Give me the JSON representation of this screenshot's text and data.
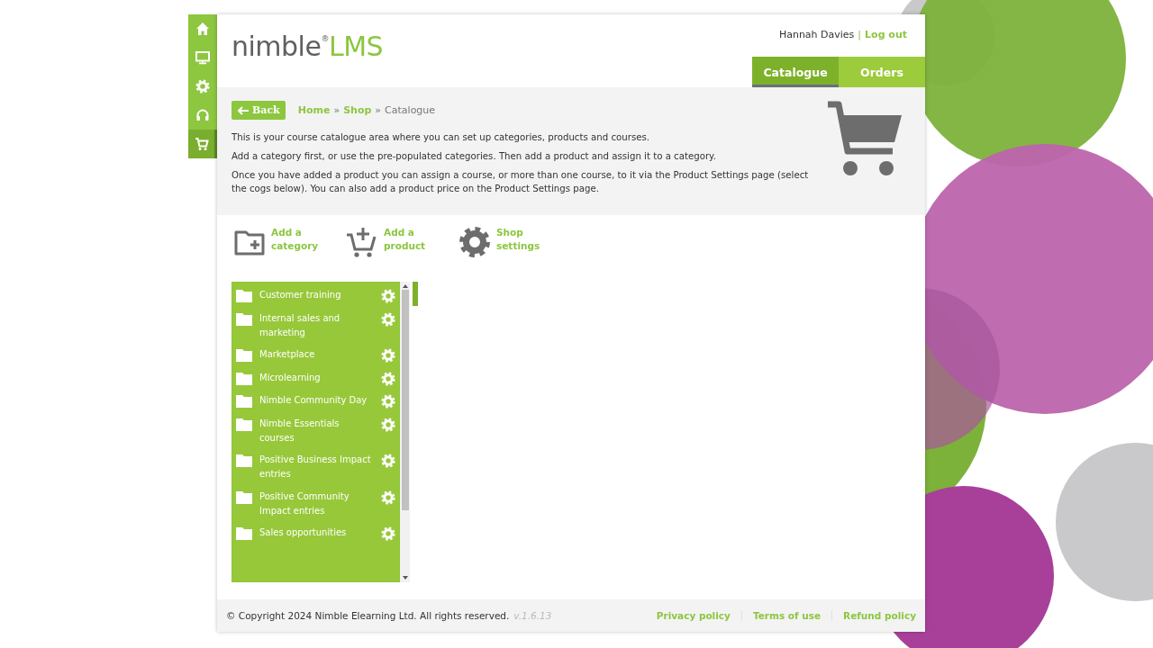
{
  "sidebar": {
    "items": [
      {
        "kind": "home",
        "selected": false
      },
      {
        "kind": "monitor",
        "selected": false
      },
      {
        "kind": "settings",
        "selected": false
      },
      {
        "kind": "headset",
        "selected": false
      },
      {
        "kind": "cart",
        "selected": true
      }
    ]
  },
  "logo": {
    "word": "nimble",
    "mark": "®",
    "product": "LMS"
  },
  "user": {
    "name": "Hannah Davies",
    "separator": "|",
    "logout": "Log out"
  },
  "tabs": [
    {
      "label": "Catalogue",
      "selected": true
    },
    {
      "label": "Orders",
      "selected": false
    }
  ],
  "back_button": "Back",
  "breadcrumb": [
    {
      "text": "Home",
      "kind": "link"
    },
    {
      "text": "»",
      "kind": "sep"
    },
    {
      "text": "Shop",
      "kind": "link"
    },
    {
      "text": "»",
      "kind": "sep"
    },
    {
      "text": "Catalogue",
      "kind": "current"
    }
  ],
  "intro": [
    "This is your course catalogue area where you can set up categories, products and courses.",
    "Add a category first, or use the pre-populated categories. Then add a product and assign it to a category.",
    "Once you have added a product you can assign a course, or more than one course, to it via the Product Settings page (select the cogs below). You can also add a product price on the Product Settings page."
  ],
  "actions": [
    {
      "kind": "folder",
      "label": "Add a category"
    },
    {
      "kind": "cart",
      "label": "Add a product"
    },
    {
      "kind": "gear",
      "label": "Shop settings"
    }
  ],
  "categories": [
    {
      "name": "Customer training"
    },
    {
      "name": "Internal sales and marketing"
    },
    {
      "name": "Marketplace"
    },
    {
      "name": "Microlearning"
    },
    {
      "name": "Nimble Community Day"
    },
    {
      "name": "Nimble Essentials courses"
    },
    {
      "name": "Positive Business Impact entries"
    },
    {
      "name": "Positive Community Impact entries"
    },
    {
      "name": "Sales opportunities"
    }
  ],
  "footer": {
    "copyright": "© Copyright 2024 Nimble Elearning Ltd. All rights reserved.",
    "version": "v.1.6.13",
    "links": [
      "Privacy policy",
      "Terms of use",
      "Refund policy"
    ]
  }
}
